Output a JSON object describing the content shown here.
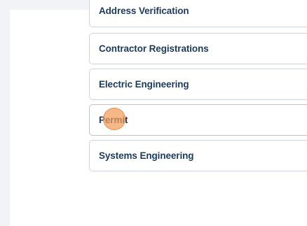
{
  "menu": {
    "items": [
      {
        "label": "Address Verification"
      },
      {
        "label": "Contractor Registrations"
      },
      {
        "label": "Electric Engineering"
      },
      {
        "label": "Permit"
      },
      {
        "label": "Systems Engineering"
      }
    ]
  },
  "colors": {
    "item_text": "#1b3a5c",
    "item_border": "#cbd5e1",
    "click_marker": "#f39c58",
    "background_strip": "#f1f3f6"
  }
}
